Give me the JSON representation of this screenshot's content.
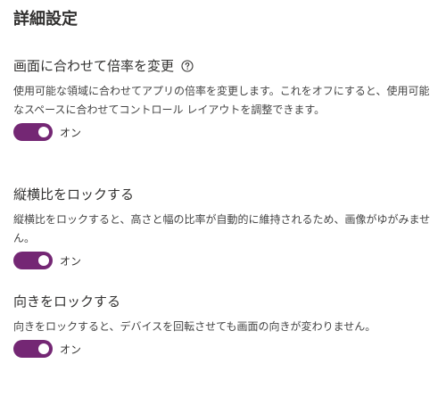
{
  "page": {
    "title": "詳細設定"
  },
  "sections": [
    {
      "heading": "画面に合わせて倍率を変更",
      "help_icon": "help-circle-icon",
      "description": "使用可能な領域に合わせてアプリの倍率を変更します。これをオフにすると、使用可能なスペースに合わせてコントロール レイアウトを調整できます。",
      "toggle": {
        "state": "on",
        "label": "オン"
      }
    },
    {
      "heading": "縦横比をロックする",
      "description": "縦横比をロックすると、高さと幅の比率が自動的に維持されるため、画像がゆがみません。",
      "toggle": {
        "state": "on",
        "label": "オン"
      }
    },
    {
      "heading": "向きをロックする",
      "description": "向きをロックすると、デバイスを回転させても画面の向きが変わりません。",
      "toggle": {
        "state": "on",
        "label": "オン"
      }
    }
  ],
  "colors": {
    "toggle_on": "#742774",
    "text": "#323130"
  }
}
